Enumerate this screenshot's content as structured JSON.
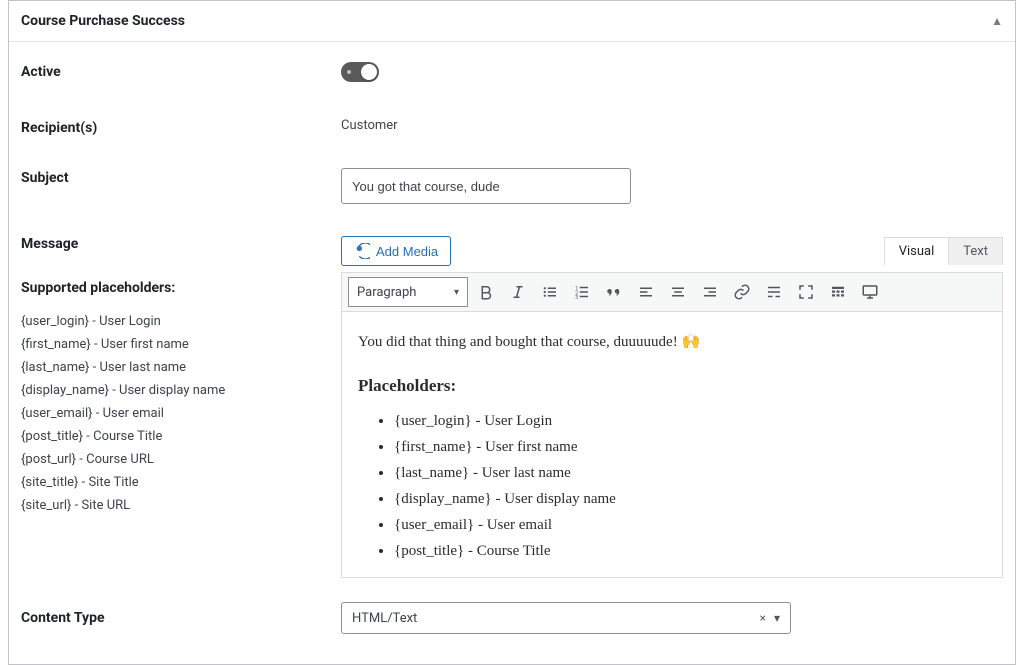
{
  "header": {
    "title": "Course Purchase Success"
  },
  "fields": {
    "active_label": "Active",
    "recipients_label": "Recipient(s)",
    "recipients_value": "Customer",
    "subject_label": "Subject",
    "subject_value": "You got that course, dude",
    "message_label": "Message",
    "supported_placeholders_label": "Supported placeholders:",
    "content_type_label": "Content Type",
    "content_type_value": "HTML/Text"
  },
  "editor": {
    "add_media_label": "Add Media",
    "tabs": {
      "visual": "Visual",
      "text": "Text"
    },
    "format_selector": "Paragraph",
    "intro": "You did that thing and bought that course, duuuuude! 🙌",
    "placeholders_heading": "Placeholders:",
    "placeholders_in_editor": [
      "{user_login} - User Login",
      "{first_name} - User first name",
      "{last_name} - User last name",
      "{display_name} - User display name",
      "{user_email} - User email",
      "{post_title} - Course Title"
    ]
  },
  "sidebar_placeholders": [
    "{user_login} - User Login",
    "{first_name} - User first name",
    "{last_name} - User last name",
    "{display_name} - User display name",
    "{user_email} - User email",
    "{post_title} - Course Title",
    "{post_url} - Course URL",
    "{site_title} - Site Title",
    "{site_url} - Site URL"
  ],
  "toolbar_buttons": [
    {
      "name": "bold-icon"
    },
    {
      "name": "italic-icon"
    },
    {
      "name": "bullet-list-icon"
    },
    {
      "name": "number-list-icon"
    },
    {
      "name": "quote-icon"
    },
    {
      "name": "align-left-icon"
    },
    {
      "name": "align-center-icon"
    },
    {
      "name": "align-right-icon"
    },
    {
      "name": "link-icon"
    },
    {
      "name": "insert-more-icon"
    },
    {
      "name": "fullscreen-icon"
    },
    {
      "name": "toolbar-toggle-icon"
    },
    {
      "name": "monitor-icon"
    }
  ]
}
